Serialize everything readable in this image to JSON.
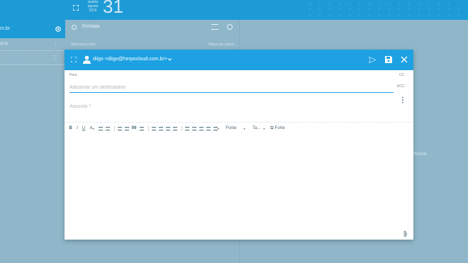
{
  "background": {
    "account_text": "m.br",
    "list_rows": [
      "ar.br",
      ""
    ],
    "date_small": [
      "quarta",
      "agosto",
      "2016"
    ],
    "date_day": "31",
    "search_value": "Entrada",
    "filter_left": "Selecionar tudo",
    "filter_right": "Filtrar por status",
    "empty_text": "nenhuma"
  },
  "dialog": {
    "from": "diigo <diigo@herpocloud.com.br>",
    "to_label": "Para",
    "to_placeholder": "Adicionar um destinatário",
    "cc_label": "CC",
    "bcc_label": "BCC",
    "subject_placeholder": "Assunto *",
    "toolbar": {
      "bold": "B",
      "italic": "I",
      "underline": "U",
      "text_color": "A",
      "quote": "99",
      "font_select": "Fonte",
      "size_select": "Ta...",
      "format_label": "Forte"
    }
  }
}
